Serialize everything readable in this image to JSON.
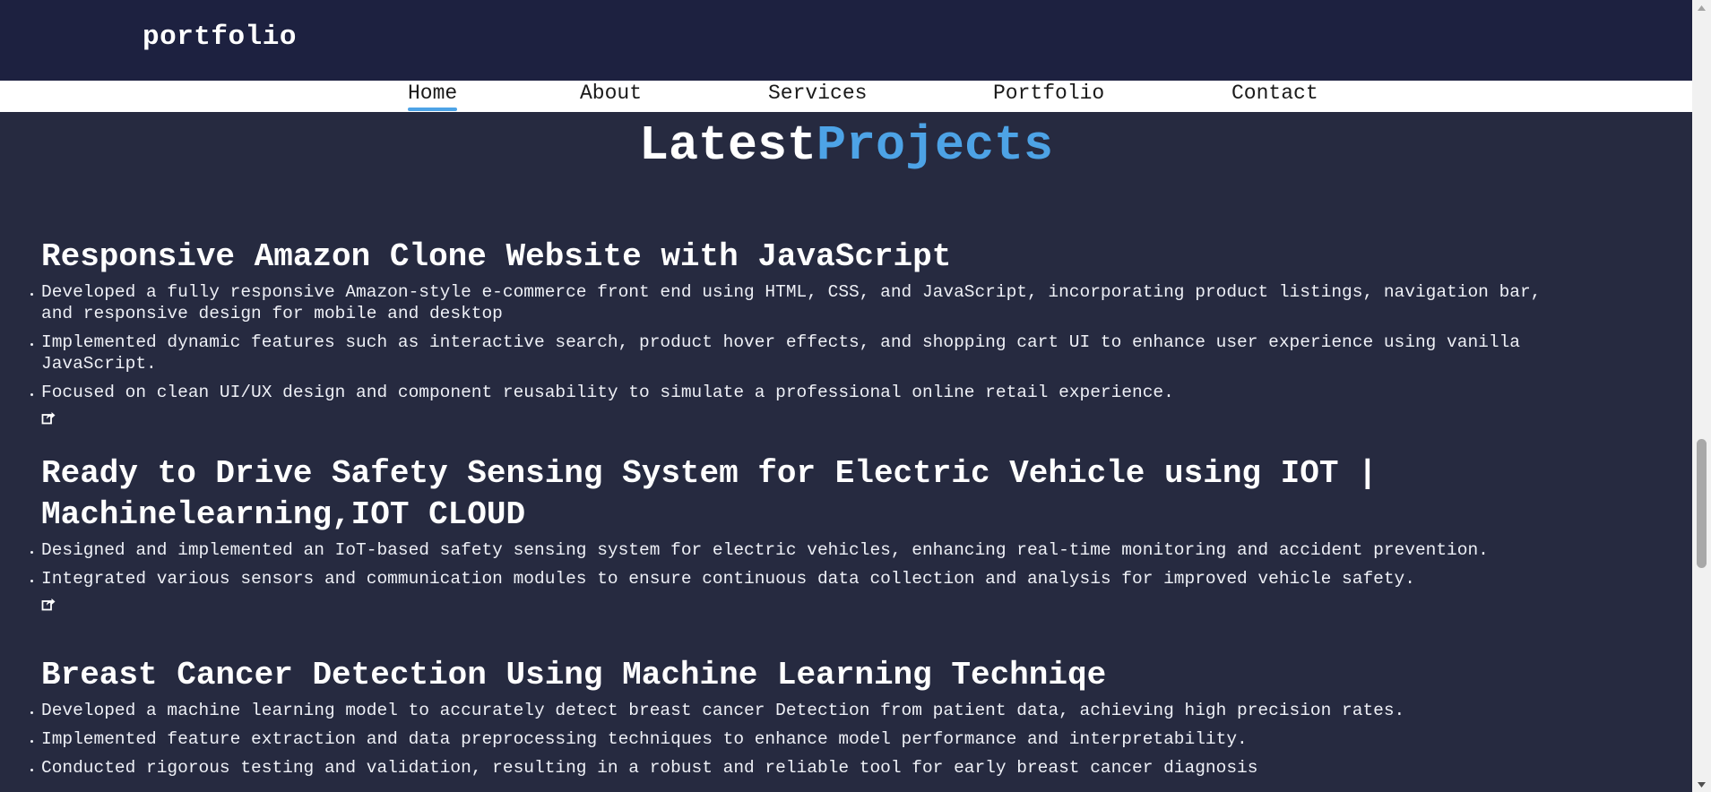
{
  "brand": {
    "logo": "portfolio"
  },
  "nav": {
    "items": [
      {
        "label": "Home",
        "active": true
      },
      {
        "label": "About",
        "active": false
      },
      {
        "label": "Services",
        "active": false
      },
      {
        "label": "Portfolio",
        "active": false
      },
      {
        "label": "Contact",
        "active": false
      }
    ]
  },
  "section": {
    "title_part1": "Latest",
    "title_part2": "Projects"
  },
  "projects": [
    {
      "title": "Responsive Amazon Clone Website with JavaScript",
      "bullets": [
        "Developed a fully responsive Amazon-style e-commerce front end using HTML, CSS, and JavaScript, incorporating product listings, navigation bar, and responsive design for mobile and desktop",
        "Implemented dynamic features such as interactive search, product hover effects, and shopping cart UI to enhance user experience using vanilla JavaScript.",
        "Focused on clean UI/UX design and component reusability to simulate a professional online retail experience."
      ],
      "link_icon": "external-link-icon"
    },
    {
      "title": "Ready to Drive Safety Sensing System for Electric Vehicle using IOT | Machinelearning,IOT CLOUD",
      "bullets": [
        "Designed and implemented an IoT-based safety sensing system for electric vehicles, enhancing real-time monitoring and accident prevention.",
        "Integrated various sensors and communication modules to ensure continuous data collection and analysis for improved vehicle safety."
      ],
      "link_icon": "external-link-icon"
    },
    {
      "title": "Breast Cancer Detection Using Machine Learning Techniqe",
      "bullets": [
        "Developed a machine learning model to accurately detect breast cancer Detection from patient data, achieving high precision rates.",
        "Implemented feature extraction and data preprocessing techniques to enhance model performance and interpretability.",
        "Conducted rigorous testing and validation, resulting in a robust and reliable tool for early breast cancer diagnosis"
      ]
    }
  ],
  "colors": {
    "topbar": "#1d2140",
    "background": "#262a40",
    "accent": "#4da3e6",
    "navbar": "#ffffff"
  }
}
